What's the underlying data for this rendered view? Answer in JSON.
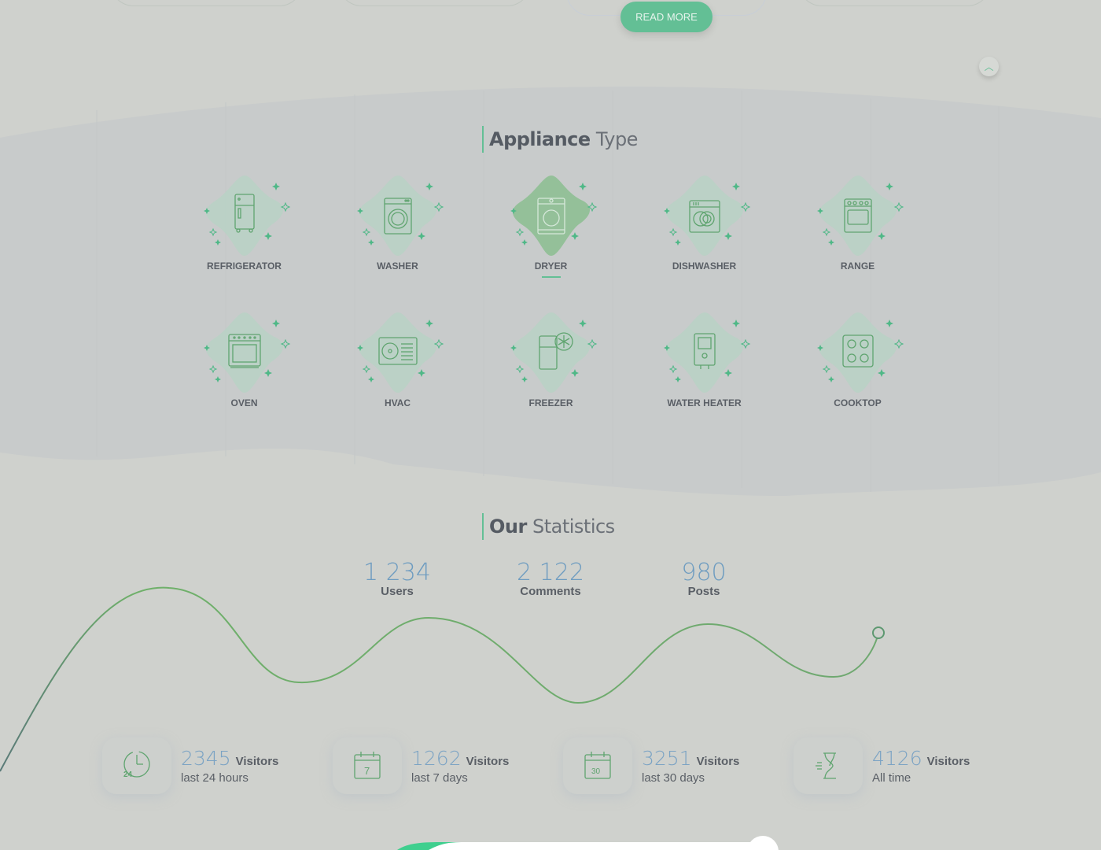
{
  "top": {
    "read_more": "READ MORE",
    "scroll_top_icon": "chevron-up-icon"
  },
  "appliances": {
    "title_bold": "Appliance",
    "title_rest": "Type",
    "items": [
      {
        "label": "REFRIGERATOR",
        "icon": "refrigerator-icon"
      },
      {
        "label": "WASHER",
        "icon": "washer-icon"
      },
      {
        "label": "DRYER",
        "icon": "dryer-icon",
        "active": true
      },
      {
        "label": "DISHWASHER",
        "icon": "dishwasher-icon"
      },
      {
        "label": "RANGE",
        "icon": "range-icon"
      },
      {
        "label": "OVEN",
        "icon": "oven-icon"
      },
      {
        "label": "HVAC",
        "icon": "hvac-icon"
      },
      {
        "label": "FREEZER",
        "icon": "freezer-icon"
      },
      {
        "label": "WATER HEATER",
        "icon": "water-heater-icon"
      },
      {
        "label": "COOKTOP",
        "icon": "cooktop-icon"
      }
    ]
  },
  "statistics": {
    "title_bold": "Our",
    "title_rest": "Statistics",
    "counters": [
      {
        "value": "1 234",
        "label": "Users"
      },
      {
        "value": "2 122",
        "label": "Comments"
      },
      {
        "value": "980",
        "label": "Posts"
      }
    ],
    "visitors": [
      {
        "value": "2345",
        "label": "Visitors",
        "period": "last 24 hours",
        "icon": "clock-24-icon"
      },
      {
        "value": "1262",
        "label": "Visitors",
        "period": "last 7 days",
        "icon": "calendar-7-icon",
        "day": "7"
      },
      {
        "value": "3251",
        "label": "Visitors",
        "period": "last 30 days",
        "icon": "calendar-30-icon",
        "day": "30"
      },
      {
        "value": "4126",
        "label": "Visitors",
        "period": "All time",
        "icon": "hourglass-icon"
      }
    ]
  },
  "colors": {
    "accent": "#63bf95",
    "number": "#6e9cc0",
    "background": "#cfd1cd"
  }
}
